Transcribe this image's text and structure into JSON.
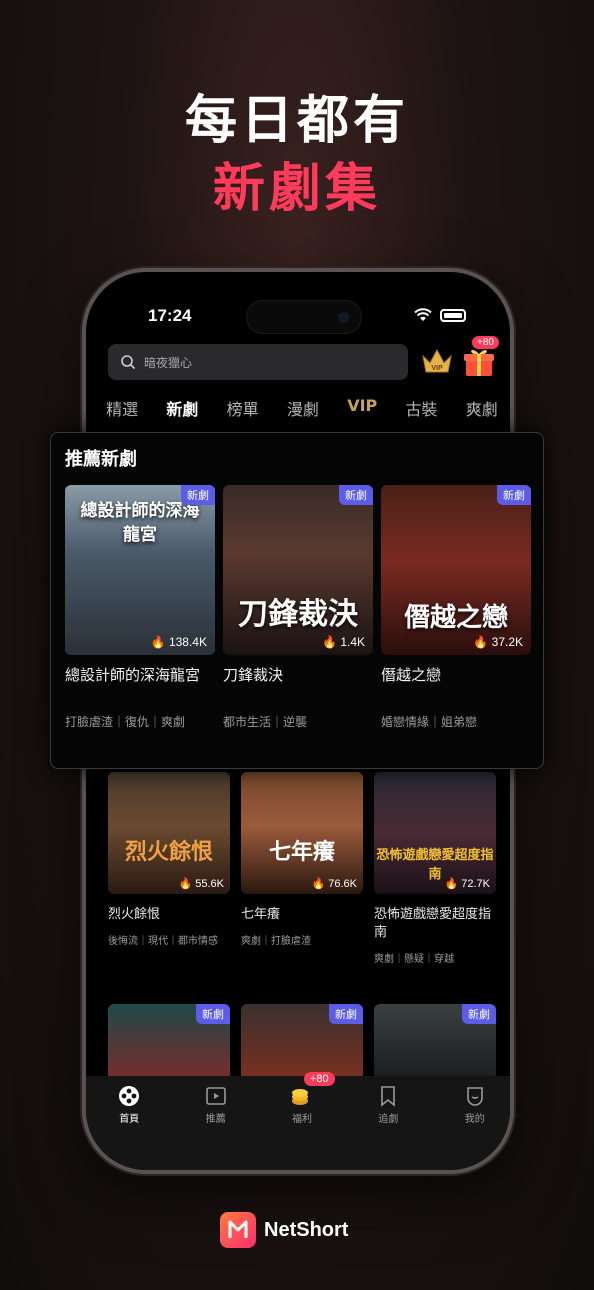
{
  "headline": {
    "line1": "每日都有",
    "line2": "新劇集"
  },
  "status_bar": {
    "time": "17:24"
  },
  "search": {
    "placeholder": "暗夜獵心"
  },
  "gift_badge": "+80",
  "tabs": [
    "精選",
    "新劇",
    "榜單",
    "漫劇",
    "VIP",
    "古裝",
    "爽劇"
  ],
  "overlay": {
    "title": "推薦新劇",
    "cards": [
      {
        "poster_text": "總設計師的深海龍宮",
        "badge": "新劇",
        "views": "138.4K",
        "title": "總設計師的深海龍宮",
        "tags": "打臉虐渣｜復仇｜爽劇"
      },
      {
        "poster_text": "刀鋒裁決",
        "badge": "新劇",
        "views": "1.4K",
        "title": "刀鋒裁決",
        "tags": "都市生活｜逆襲"
      },
      {
        "poster_text": "僭越之戀",
        "badge": "新劇",
        "views": "37.2K",
        "title": "僭越之戀",
        "tags": "婚戀情緣｜姐弟戀"
      }
    ]
  },
  "grid_row1": [
    {
      "poster_text": "烈火餘恨",
      "views": "55.6K",
      "title": "烈火餘恨",
      "tags": "後悔流｜現代｜都市情感"
    },
    {
      "poster_text": "七年癢",
      "views": "76.6K",
      "title": "七年癢",
      "tags": "爽劇｜打臉虐渣"
    },
    {
      "poster_text": "恐怖遊戲戀愛超度指南",
      "views": "72.7K",
      "title": "恐怖遊戲戀愛超度指南",
      "tags": "爽劇｜懸疑｜穿越"
    }
  ],
  "grid_row2": [
    {
      "badge": "新劇"
    },
    {
      "badge": "新劇"
    },
    {
      "badge": "新劇"
    }
  ],
  "bottom_nav": [
    {
      "label": "首頁",
      "icon": "home-icon"
    },
    {
      "label": "推薦",
      "icon": "play-icon"
    },
    {
      "label": "福利",
      "icon": "coin-icon"
    },
    {
      "label": "追劇",
      "icon": "bookmark-icon"
    },
    {
      "label": "我的",
      "icon": "profile-icon"
    }
  ],
  "welfare_badge": "+80",
  "brand": {
    "name": "NetShort"
  },
  "colors": {
    "accent": "#ff3b5c",
    "badge": "#5c5ce8",
    "vip": "#c9a35a"
  }
}
